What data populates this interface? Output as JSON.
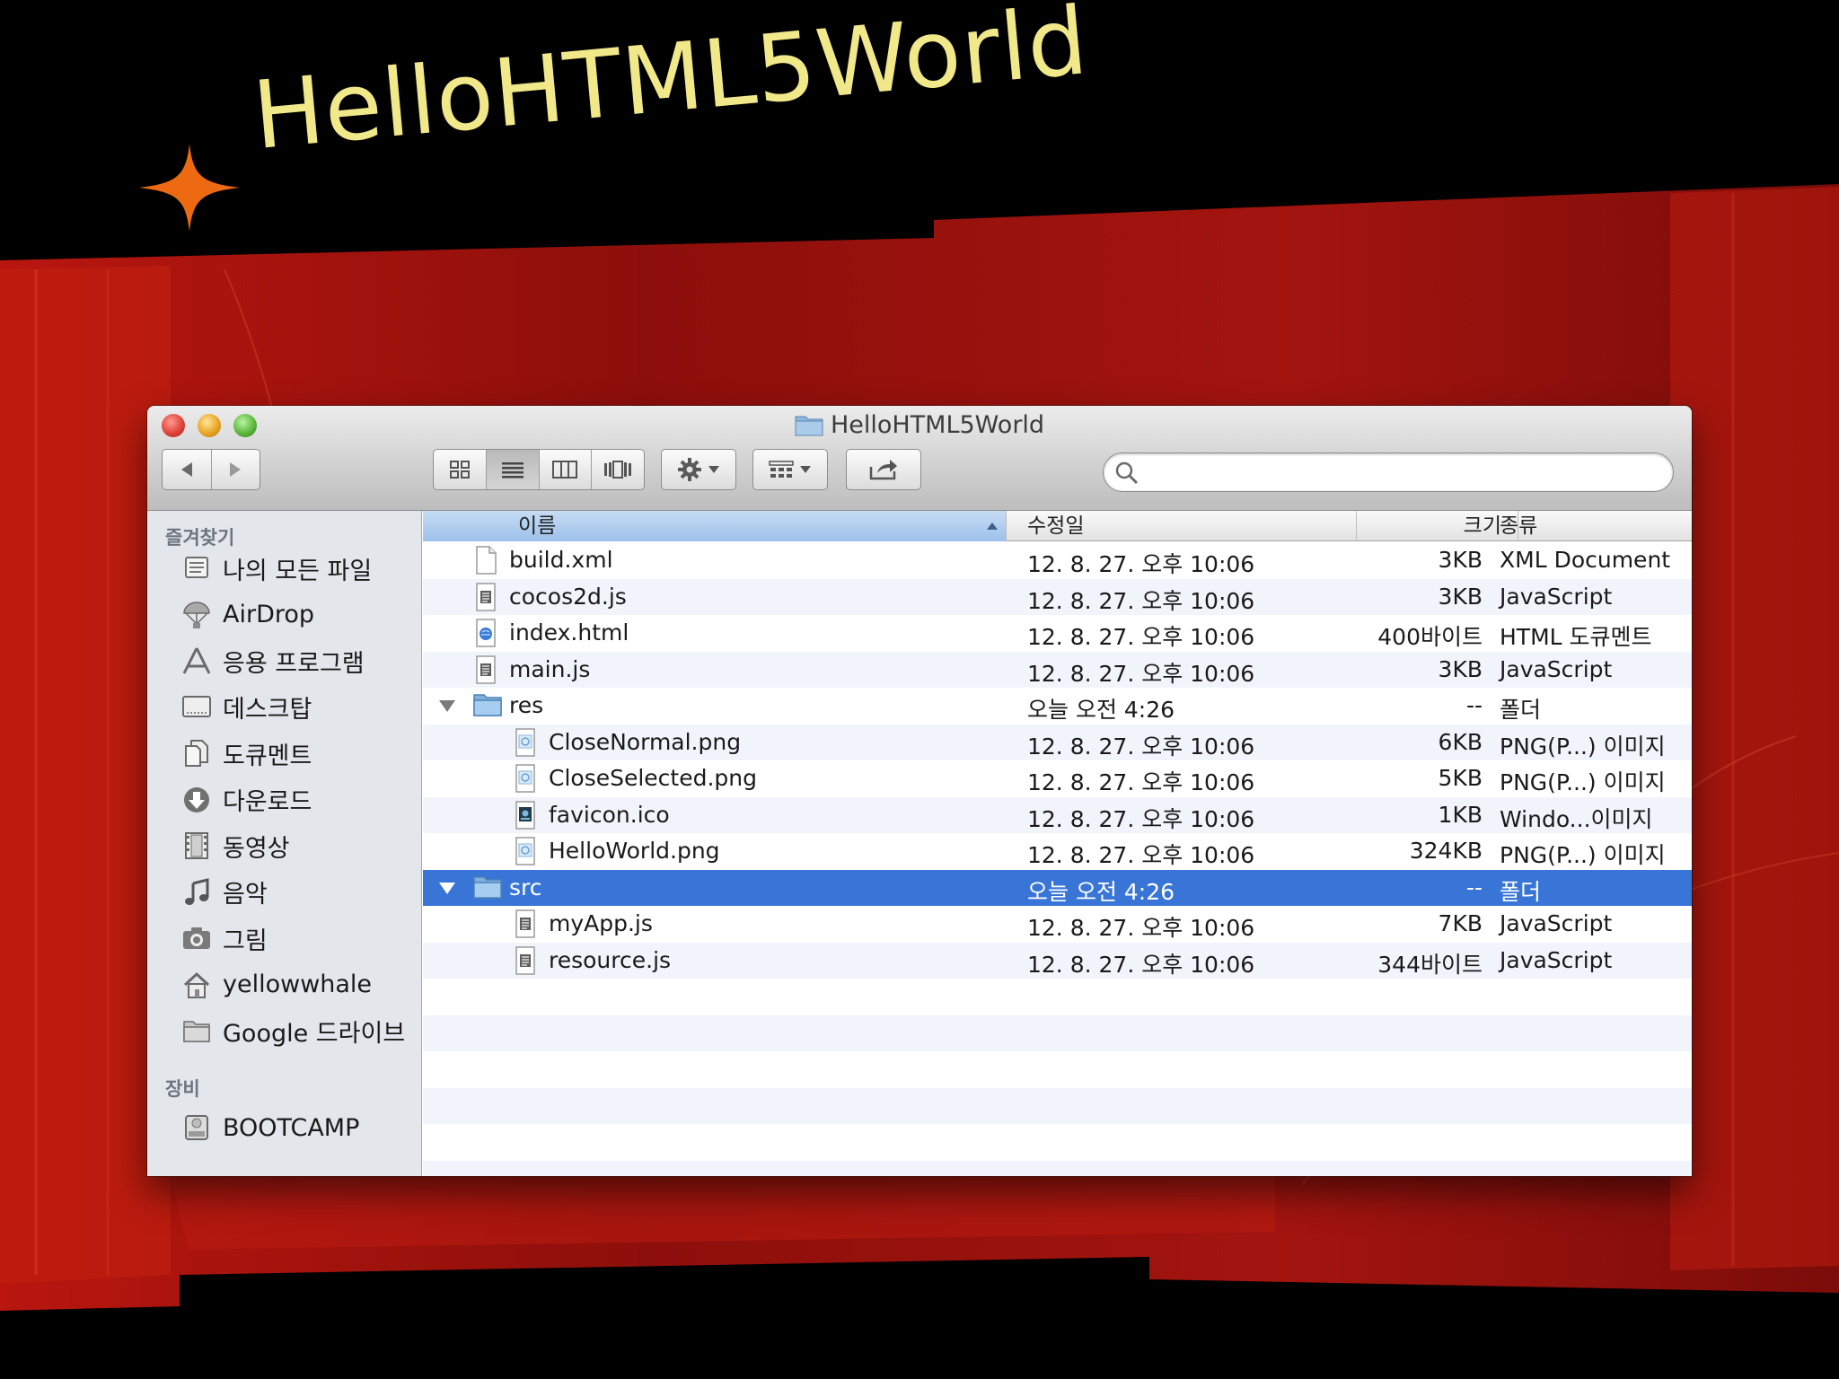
{
  "slide": {
    "title": "HelloHTML5World"
  },
  "window": {
    "title": "HelloHTML5World",
    "search_placeholder": ""
  },
  "sidebar": {
    "favorites_heading": "즐겨찾기",
    "devices_heading": "장비",
    "favorites": [
      {
        "label": "나의 모든 파일",
        "icon": "all-files-icon"
      },
      {
        "label": "AirDrop",
        "icon": "airdrop-icon"
      },
      {
        "label": "응용 프로그램",
        "icon": "applications-icon"
      },
      {
        "label": "데스크탑",
        "icon": "desktop-icon"
      },
      {
        "label": "도큐멘트",
        "icon": "documents-icon"
      },
      {
        "label": "다운로드",
        "icon": "downloads-icon"
      },
      {
        "label": "동영상",
        "icon": "movies-icon"
      },
      {
        "label": "음악",
        "icon": "music-icon"
      },
      {
        "label": "그림",
        "icon": "pictures-icon"
      },
      {
        "label": "yellowwhale",
        "icon": "home-icon"
      },
      {
        "label": "Google 드라이브",
        "icon": "folder-icon"
      }
    ],
    "devices": [
      {
        "label": "BOOTCAMP",
        "icon": "disk-icon"
      }
    ]
  },
  "columns": {
    "name": "이름",
    "date": "수정일",
    "size": "크기",
    "kind": "종류"
  },
  "files": [
    {
      "name": "build.xml",
      "date": "12. 8. 27. 오후 10:06",
      "size": "3KB",
      "kind": "XML Document",
      "icon": "xml-file-icon"
    },
    {
      "name": "cocos2d.js",
      "date": "12. 8. 27. 오후 10:06",
      "size": "3KB",
      "kind": "JavaScript",
      "icon": "js-file-icon"
    },
    {
      "name": "index.html",
      "date": "12. 8. 27. 오후 10:06",
      "size": "400바이트",
      "kind": "HTML 도큐멘트",
      "icon": "html-file-icon"
    },
    {
      "name": "main.js",
      "date": "12. 8. 27. 오후 10:06",
      "size": "3KB",
      "kind": "JavaScript",
      "icon": "js-file-icon"
    },
    {
      "name": "res",
      "date": "오늘 오전 4:26",
      "size": "--",
      "kind": "폴더",
      "icon": "folder-icon"
    },
    {
      "name": "CloseNormal.png",
      "date": "12. 8. 27. 오후 10:06",
      "size": "6KB",
      "kind": "PNG(P...) 이미지",
      "icon": "png-file-icon"
    },
    {
      "name": "CloseSelected.png",
      "date": "12. 8. 27. 오후 10:06",
      "size": "5KB",
      "kind": "PNG(P...) 이미지",
      "icon": "png-file-icon"
    },
    {
      "name": "favicon.ico",
      "date": "12. 8. 27. 오후 10:06",
      "size": "1KB",
      "kind": "Windo...이미지",
      "icon": "ico-file-icon"
    },
    {
      "name": "HelloWorld.png",
      "date": "12. 8. 27. 오후 10:06",
      "size": "324KB",
      "kind": "PNG(P...) 이미지",
      "icon": "png-file-icon"
    },
    {
      "name": "src",
      "date": "오늘 오전 4:26",
      "size": "--",
      "kind": "폴더",
      "icon": "folder-icon"
    },
    {
      "name": "myApp.js",
      "date": "12. 8. 27. 오후 10:06",
      "size": "7KB",
      "kind": "JavaScript",
      "icon": "js-file-icon"
    },
    {
      "name": "resource.js",
      "date": "12. 8. 27. 오후 10:06",
      "size": "344바이트",
      "kind": "JavaScript",
      "icon": "js-file-icon"
    }
  ],
  "colors": {
    "selection": "#3875d7",
    "title_text": "#f1e88a",
    "backdrop_red": "#a01712",
    "star": "#ee6a12"
  }
}
